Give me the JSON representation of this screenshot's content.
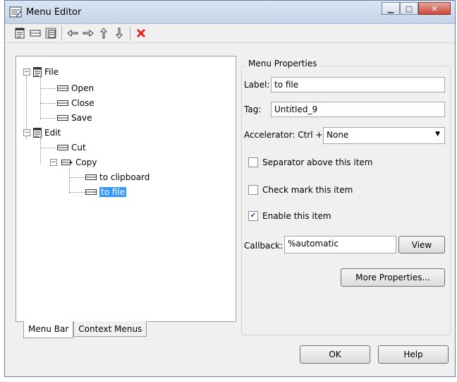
{
  "window": {
    "title": "Menu Editor"
  },
  "tree": [
    {
      "label": "File",
      "level": 0,
      "expanded": true
    },
    {
      "label": "Open",
      "level": 1
    },
    {
      "label": "Close",
      "level": 1
    },
    {
      "label": "Save",
      "level": 1
    },
    {
      "label": "Edit",
      "level": 0,
      "expanded": true
    },
    {
      "label": "Cut",
      "level": 1
    },
    {
      "label": "Copy",
      "level": 1,
      "expanded": true
    },
    {
      "label": "to clipboard",
      "level": 2
    },
    {
      "label": "to file",
      "level": 2,
      "selected": true
    }
  ],
  "tabs": {
    "menu_bar": "Menu Bar",
    "context_menus": "Context Menus"
  },
  "props": {
    "title": "Menu Properties",
    "label_label": "Label:",
    "label_value": "to file",
    "tag_label": "Tag:",
    "tag_value": "Untitled_9",
    "accelerator_label": "Accelerator: Ctrl +",
    "accelerator_value": "None",
    "separator_label": "Separator above this item",
    "separator_checked": false,
    "checkmark_label": "Check mark this item",
    "checkmark_checked": false,
    "enable_label": "Enable this item",
    "enable_checked": true,
    "callback_label": "Callback:",
    "callback_value": "%automatic",
    "view_button": "View",
    "more_button": "More Properties..."
  },
  "footer": {
    "ok": "OK",
    "help": "Help"
  },
  "colors": {
    "selection": "#3399ff",
    "delete": "#e0221b"
  }
}
